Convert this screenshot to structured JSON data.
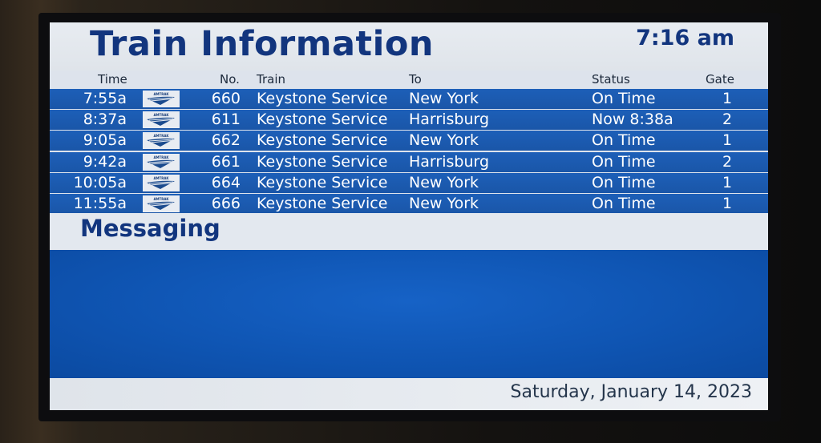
{
  "header": {
    "title": "Train Information",
    "clock": "7:16 am"
  },
  "columns": {
    "time": "Time",
    "no": "No.",
    "train": "Train",
    "to": "To",
    "status": "Status",
    "gate": "Gate"
  },
  "carrier_logo": {
    "icon": "amtrak-logo-icon",
    "text": "AMTRAK"
  },
  "departures": [
    {
      "time": "7:55a",
      "no": "660",
      "train": "Keystone Service",
      "to": "New York",
      "status": "On Time",
      "gate": "1"
    },
    {
      "time": "8:37a",
      "no": "611",
      "train": "Keystone Service",
      "to": "Harrisburg",
      "status": "Now 8:38a",
      "gate": "2"
    },
    {
      "time": "9:05a",
      "no": "662",
      "train": "Keystone Service",
      "to": "New York",
      "status": "On Time",
      "gate": "1"
    },
    {
      "time": "9:42a",
      "no": "661",
      "train": "Keystone Service",
      "to": "Harrisburg",
      "status": "On Time",
      "gate": "2"
    },
    {
      "time": "10:05a",
      "no": "664",
      "train": "Keystone Service",
      "to": "New York",
      "status": "On Time",
      "gate": "1"
    },
    {
      "time": "11:55a",
      "no": "666",
      "train": "Keystone Service",
      "to": "New York",
      "status": "On Time",
      "gate": "1"
    }
  ],
  "messaging": {
    "title": "Messaging",
    "body": ""
  },
  "footer": {
    "date": "Saturday, January 14, 2023"
  },
  "colors": {
    "brand_navy": "#12357e",
    "row_blue": "#1d5fb8",
    "panel_light": "#dde3ec"
  }
}
